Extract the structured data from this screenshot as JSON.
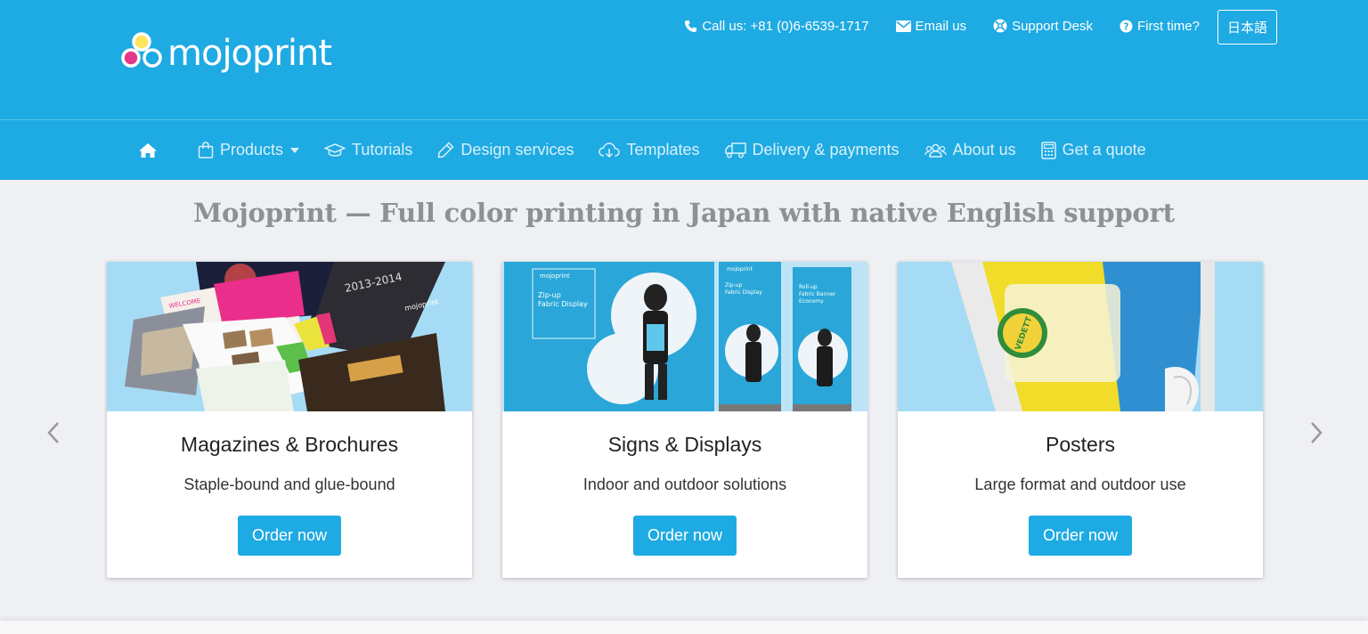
{
  "brand": {
    "name": "mojoprint",
    "primary_color": "#1eaae2"
  },
  "topbar": {
    "phone_label": "Call us: +81 (0)6-6539-1717",
    "email_label": "Email us",
    "support_label": "Support Desk",
    "first_time_label": "First time?",
    "language_label": "日本語"
  },
  "nav": {
    "home_icon": "home-icon",
    "items": [
      {
        "label": "Products",
        "icon": "bag-icon"
      },
      {
        "label": "Tutorials",
        "icon": "graduation-cap-icon"
      },
      {
        "label": "Design services",
        "icon": "pencil-icon"
      },
      {
        "label": "Templates",
        "icon": "cloud-download-icon"
      },
      {
        "label": "Delivery & payments",
        "icon": "truck-icon"
      },
      {
        "label": "About us",
        "icon": "users-icon"
      },
      {
        "label": "Get a quote",
        "icon": "calculator-icon"
      }
    ]
  },
  "hero": {
    "title": "Mojoprint — Full color printing in Japan with native English support"
  },
  "cards": [
    {
      "title": "Magazines & Brochures",
      "subtitle": "Staple-bound and glue-bound",
      "button": "Order now"
    },
    {
      "title": "Signs & Displays",
      "subtitle": "Indoor and outdoor solutions",
      "button": "Order now"
    },
    {
      "title": "Posters",
      "subtitle": "Large format and outdoor use",
      "button": "Order now"
    }
  ],
  "card_images": {
    "magazine_year": "2013-2014",
    "magazine_welcome": "WELCOME",
    "magazine_brand": "mojoprint",
    "display_brand": "mojoprint",
    "display_zipup": "Zip-up",
    "display_fabric": "Fabric Display",
    "display_rollup": "Roll-up",
    "display_banner": "Fabric Banner",
    "display_economy": "Economy",
    "poster_text": "VEDETT"
  }
}
